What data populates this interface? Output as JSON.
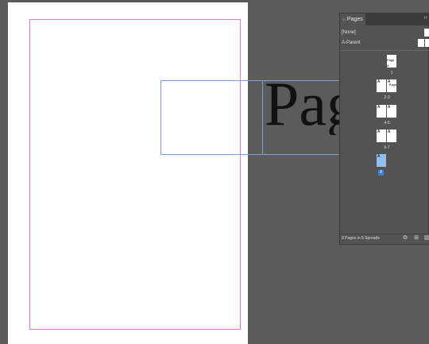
{
  "document": {
    "frame_text": "Page"
  },
  "pages_panel": {
    "tab_label": "Pages",
    "collapse_label": "››",
    "parents": [
      {
        "label": "[None]"
      },
      {
        "label": "A-Parent"
      }
    ],
    "spreads": [
      {
        "label": "1",
        "pages": [
          {
            "letter": "",
            "tag": "Page A"
          }
        ]
      },
      {
        "label": "2-3",
        "pages": [
          {
            "letter": "A",
            "tag": ""
          },
          {
            "letter": "A",
            "tag": "Page"
          }
        ]
      },
      {
        "label": "4-5",
        "pages": [
          {
            "letter": "A",
            "tag": ""
          },
          {
            "letter": "A",
            "tag": ""
          }
        ]
      },
      {
        "label": "6-7",
        "pages": [
          {
            "letter": "A",
            "tag": ""
          },
          {
            "letter": "A",
            "tag": ""
          }
        ]
      },
      {
        "label": "8",
        "pages": [
          {
            "letter": "A",
            "tag": "",
            "selected": true
          }
        ]
      }
    ],
    "footer_text": "8 Pages in 5 Spreads"
  }
}
